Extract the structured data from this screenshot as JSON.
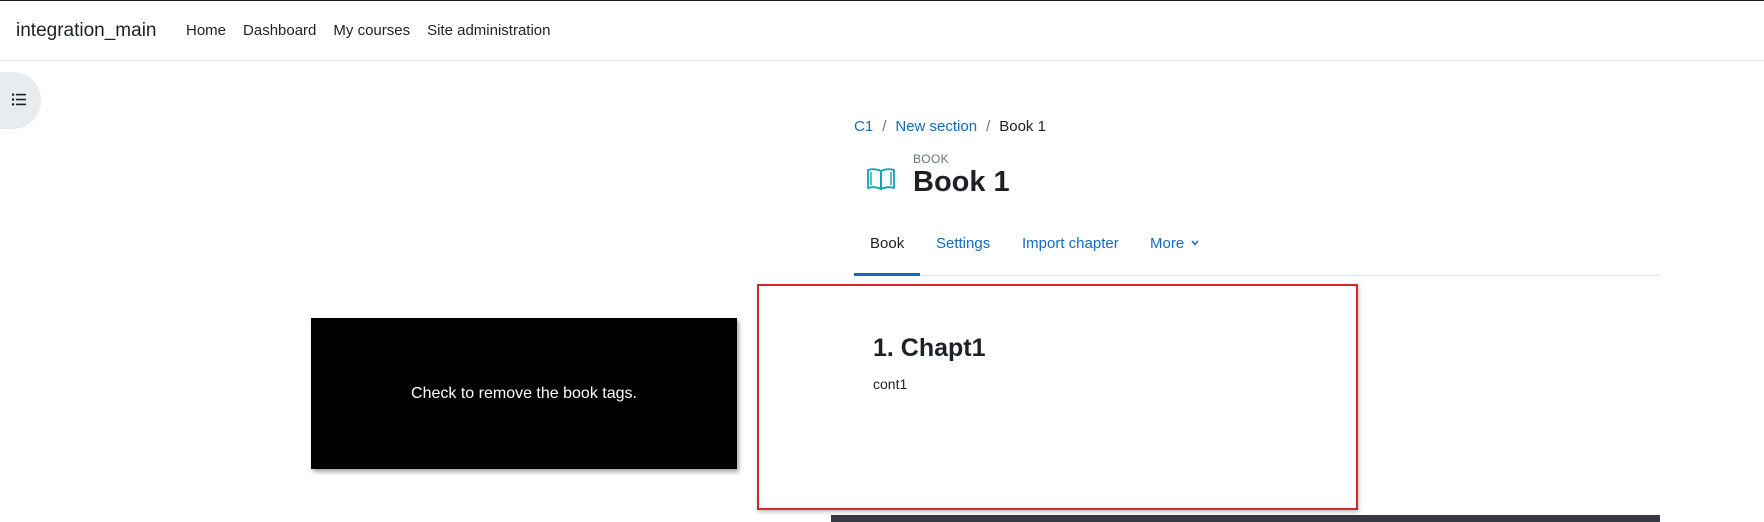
{
  "navbar": {
    "brand": "integration_main",
    "items": [
      {
        "label": "Home"
      },
      {
        "label": "Dashboard"
      },
      {
        "label": "My courses"
      },
      {
        "label": "Site administration"
      }
    ]
  },
  "breadcrumb": {
    "items": [
      {
        "label": "C1"
      },
      {
        "label": "New section"
      }
    ],
    "current": "Book 1",
    "separator": "/"
  },
  "header": {
    "module_type": "BOOK",
    "title": "Book 1",
    "icon": "book-icon"
  },
  "secondary_nav": {
    "tabs": [
      {
        "label": "Book",
        "active": true
      },
      {
        "label": "Settings"
      },
      {
        "label": "Import chapter"
      },
      {
        "label": "More"
      }
    ]
  },
  "tour": {
    "message": "Check to remove the book tags."
  },
  "chapter": {
    "title": "1. Chapt1",
    "content": "cont1"
  },
  "colors": {
    "link": "#0f6cbf",
    "highlight_border": "#d9232e",
    "tour_background": "#000000"
  }
}
